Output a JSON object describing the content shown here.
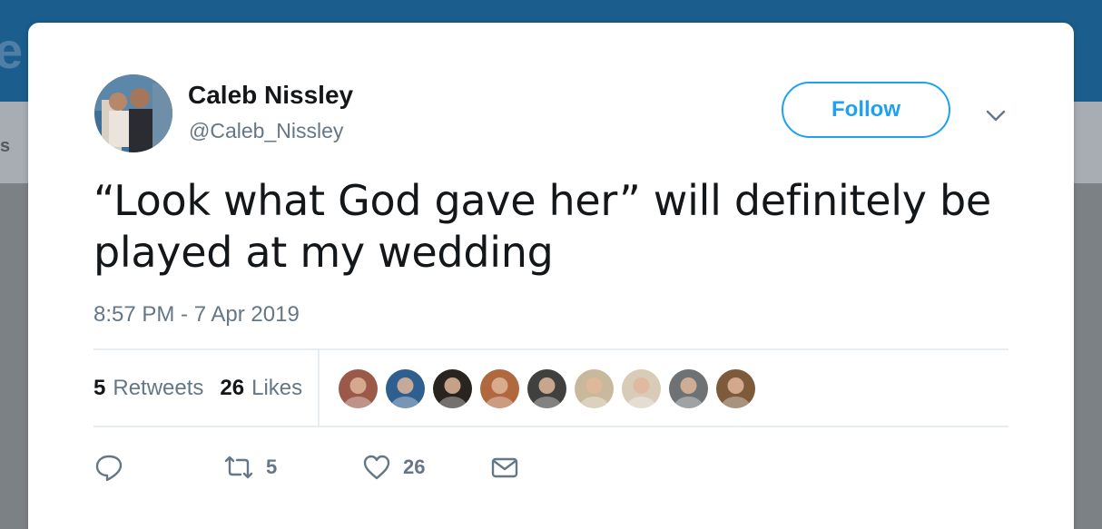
{
  "background": {
    "letters": "e I",
    "side_letter": "s"
  },
  "tweet": {
    "author": {
      "name": "Caleb Nissley",
      "handle": "@Caleb_Nissley"
    },
    "follow_label": "Follow",
    "text": "“Look what God gave her” will definitely be played at my wedding",
    "timestamp": "8:57 PM - 7 Apr 2019",
    "stats": {
      "retweets_count": "5",
      "retweets_label": "Retweets",
      "likes_count": "26",
      "likes_label": "Likes"
    },
    "likers": [
      {
        "name": "liker-1",
        "color": "#9b5a49"
      },
      {
        "name": "liker-2",
        "color": "#2f5f8f"
      },
      {
        "name": "liker-3",
        "color": "#2a2420"
      },
      {
        "name": "liker-4",
        "color": "#b0683e"
      },
      {
        "name": "liker-5",
        "color": "#40403f"
      },
      {
        "name": "liker-6",
        "color": "#c9b99c"
      },
      {
        "name": "liker-7",
        "color": "#d8cbb8"
      },
      {
        "name": "liker-8",
        "color": "#6e7275"
      },
      {
        "name": "liker-9",
        "color": "#7d5a3a"
      }
    ],
    "actions": {
      "reply_count": "",
      "retweet_count": "5",
      "like_count": "26"
    },
    "icons": {
      "reply": "reply-icon",
      "retweet": "retweet-icon",
      "like": "heart-icon",
      "dm": "envelope-icon",
      "caret": "chevron-down-icon"
    },
    "colors": {
      "accent": "#1da1f2",
      "text": "#14171a",
      "muted": "#657786"
    }
  }
}
